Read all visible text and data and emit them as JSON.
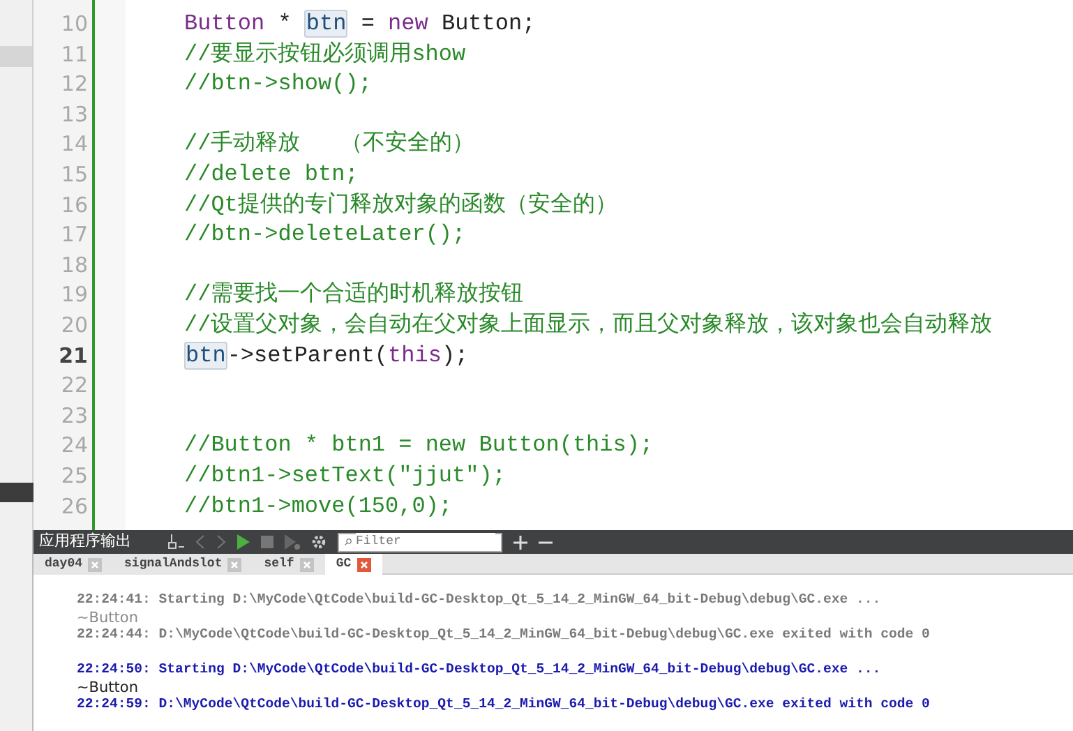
{
  "editor": {
    "lines": [
      {
        "number": "10",
        "current": false,
        "segments": [
          {
            "kind": "keyword",
            "text": "Button"
          },
          {
            "kind": "plain",
            "text": " * "
          },
          {
            "kind": "highlight",
            "text": "btn"
          },
          {
            "kind": "plain",
            "text": " = "
          },
          {
            "kind": "keyword",
            "text": "new"
          },
          {
            "kind": "plain",
            "text": " Button;"
          }
        ]
      },
      {
        "number": "11",
        "current": false,
        "segments": [
          {
            "kind": "comment",
            "text": "//要显示按钮必须调用show"
          }
        ]
      },
      {
        "number": "12",
        "current": false,
        "segments": [
          {
            "kind": "comment",
            "text": "//btn->show();"
          }
        ]
      },
      {
        "number": "13",
        "current": false
      },
      {
        "number": "14",
        "current": false,
        "segments": [
          {
            "kind": "comment",
            "text": "//手动释放   （不安全的）"
          }
        ]
      },
      {
        "number": "15",
        "current": false,
        "segments": [
          {
            "kind": "comment",
            "text": "//delete btn;"
          }
        ]
      },
      {
        "number": "16",
        "current": false,
        "segments": [
          {
            "kind": "comment",
            "text": "//Qt提供的专门释放对象的函数（安全的）"
          }
        ]
      },
      {
        "number": "17",
        "current": false,
        "segments": [
          {
            "kind": "comment",
            "text": "//btn->deleteLater();"
          }
        ]
      },
      {
        "number": "18",
        "current": false
      },
      {
        "number": "19",
        "current": false,
        "segments": [
          {
            "kind": "comment",
            "text": "//需要找一个合适的时机释放按钮"
          }
        ]
      },
      {
        "number": "20",
        "current": false,
        "segments": [
          {
            "kind": "comment",
            "text": "//设置父对象，会自动在父对象上面显示，而且父对象释放，该对象也会自动释放"
          }
        ]
      },
      {
        "number": "21",
        "current": true,
        "segments": [
          {
            "kind": "highlight",
            "text": "btn"
          },
          {
            "kind": "plain",
            "text": "->setParent("
          },
          {
            "kind": "keyword",
            "text": "this"
          },
          {
            "kind": "plain",
            "text": ");"
          }
        ]
      },
      {
        "number": "22",
        "current": false
      },
      {
        "number": "23",
        "current": false
      },
      {
        "number": "24",
        "current": false,
        "segments": [
          {
            "kind": "comment",
            "text": "//Button * btn1 = new Button(this);"
          }
        ]
      },
      {
        "number": "25",
        "current": false,
        "segments": [
          {
            "kind": "comment",
            "text": "//btn1->setText(\"jjut\");"
          }
        ]
      },
      {
        "number": "26",
        "current": false,
        "segments": [
          {
            "kind": "comment",
            "text": "//btn1->move(150,0);"
          }
        ]
      }
    ]
  },
  "output_pane": {
    "title": "应用程序输出",
    "filter": {
      "placeholder": "Filter"
    },
    "tabs": [
      {
        "label": "day04",
        "selected": false
      },
      {
        "label": "signalAndslot",
        "selected": false
      },
      {
        "label": "self",
        "selected": false
      },
      {
        "label": "GC",
        "selected": true
      }
    ],
    "lines": [
      {
        "kind": "old",
        "text": "22:24:41: Starting D:\\MyCode\\QtCode\\build-GC-Desktop_Qt_5_14_2_MinGW_64_bit-Debug\\debug\\GC.exe ..."
      },
      {
        "kind": "old-plain",
        "text": "~Button"
      },
      {
        "kind": "old",
        "text": "22:24:44: D:\\MyCode\\QtCode\\build-GC-Desktop_Qt_5_14_2_MinGW_64_bit-Debug\\debug\\GC.exe exited with code 0"
      },
      {
        "kind": "gap"
      },
      {
        "kind": "new",
        "text": "22:24:50: Starting D:\\MyCode\\QtCode\\build-GC-Desktop_Qt_5_14_2_MinGW_64_bit-Debug\\debug\\GC.exe ..."
      },
      {
        "kind": "new-plain",
        "text": "~Button"
      },
      {
        "kind": "new",
        "text": "22:24:59: D:\\MyCode\\QtCode\\build-GC-Desktop_Qt_5_14_2_MinGW_64_bit-Debug\\debug\\GC.exe exited with code 0"
      }
    ]
  }
}
